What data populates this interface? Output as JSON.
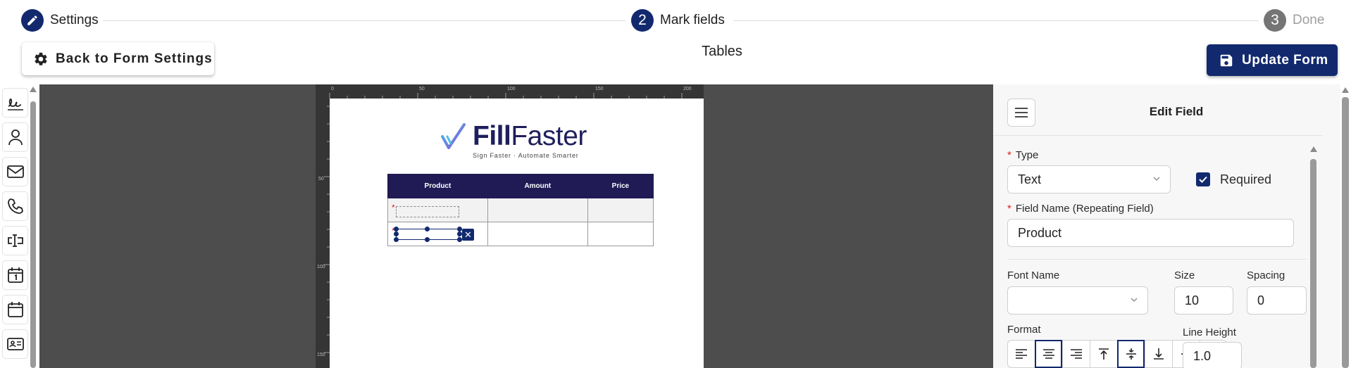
{
  "stepper": {
    "steps": [
      {
        "number": "",
        "label": "Settings",
        "state": "completed"
      },
      {
        "number": "2",
        "label": "Mark fields",
        "state": "active"
      },
      {
        "number": "3",
        "label": "Done",
        "state": "upcoming"
      }
    ]
  },
  "header": {
    "back_label": "Back to Form Settings",
    "title": "Tables",
    "update_label": "Update Form"
  },
  "toolbar": {
    "tools": [
      "signature-icon",
      "person-icon",
      "mail-icon",
      "phone-icon",
      "input-icon",
      "calendar-day-icon",
      "calendar-icon",
      "id-card-icon"
    ]
  },
  "document": {
    "logo_bold": "Fill",
    "logo_rest": "Faster",
    "logo_tagline": "Sign Faster · Automate Smarter",
    "ruler_top": [
      "0",
      "50",
      "100",
      "150",
      "200"
    ],
    "ruler_left": [
      "50",
      "100",
      "150"
    ],
    "table_headers": [
      "Product",
      "Amount",
      "Price"
    ]
  },
  "panel": {
    "title": "Edit Field",
    "type_label": "Type",
    "type_value": "Text",
    "required_label": "Required",
    "required_checked": true,
    "field_name_label": "Field Name (Repeating Field)",
    "field_name_value": "Product",
    "font_name_label": "Font Name",
    "font_name_value": "",
    "size_label": "Size",
    "size_value": "10",
    "spacing_label": "Spacing",
    "spacing_value": "0",
    "format_label": "Format",
    "format_buttons": [
      "align-left-icon",
      "align-center-icon",
      "align-right-icon",
      "align-top-icon",
      "align-middle-icon",
      "align-bottom-icon",
      "strikethrough-icon",
      "underline-icon"
    ],
    "format_active": [
      "align-center-icon",
      "align-middle-icon"
    ],
    "line_height_label": "Line Height",
    "line_height_value": "1.0"
  },
  "colors": {
    "primary": "#12296e",
    "table_header": "#201b54",
    "canvas": "#4d4d4d",
    "required": "#e02020"
  }
}
